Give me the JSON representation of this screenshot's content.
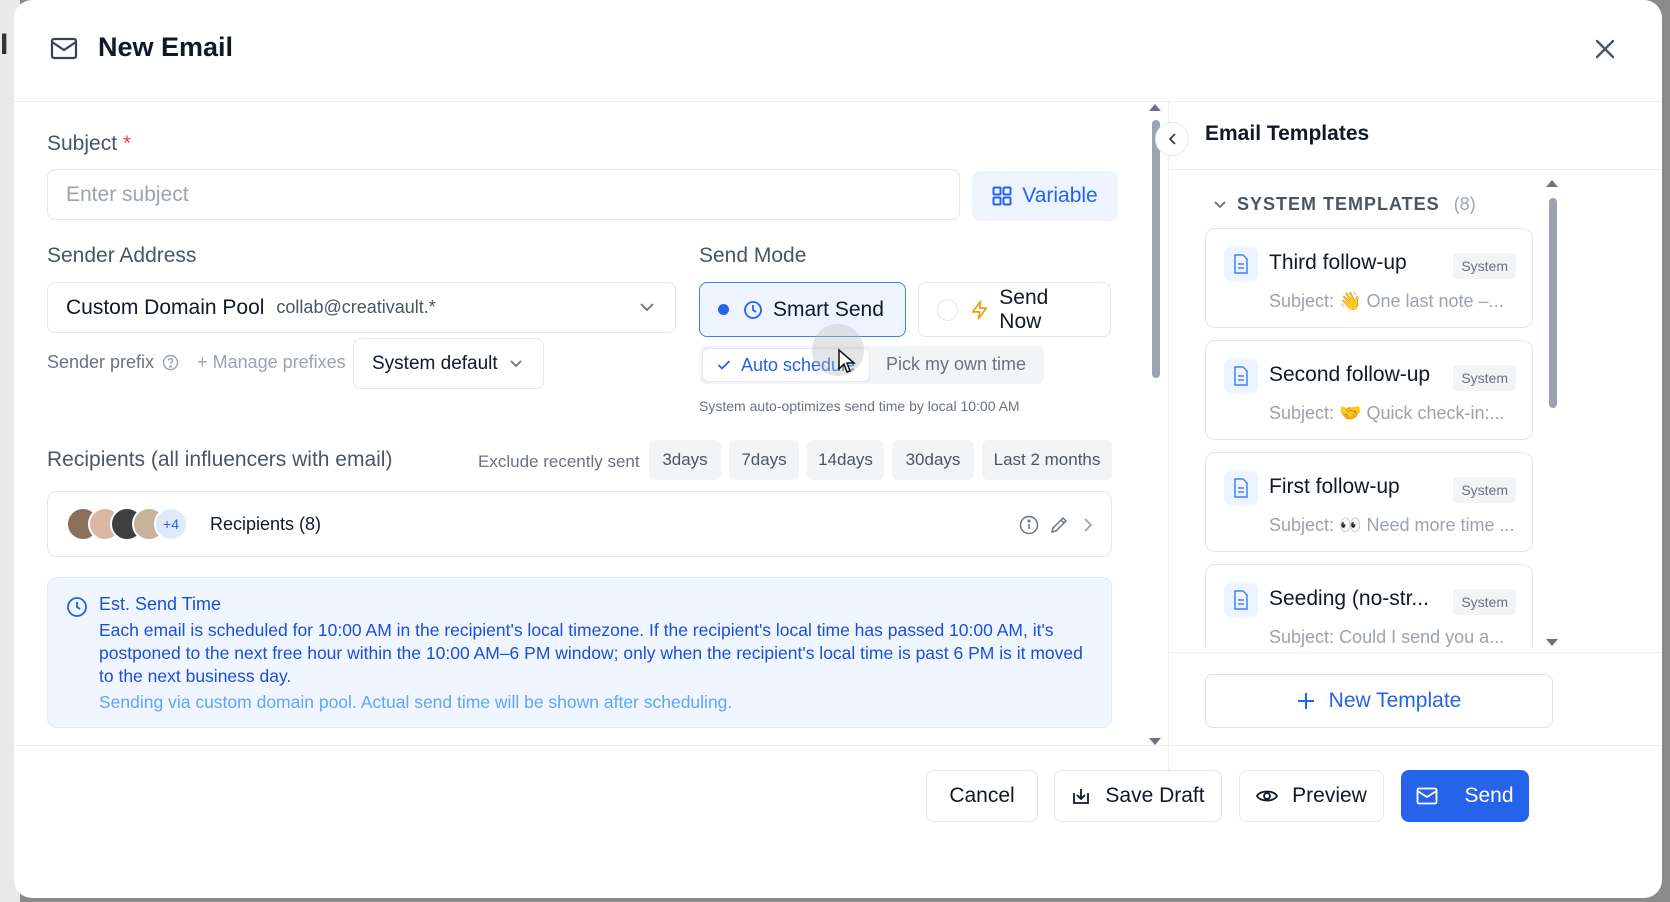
{
  "modal": {
    "title": "New Email",
    "icon": "mail-icon"
  },
  "subject": {
    "label": "Subject",
    "required_mark": "*",
    "placeholder": "Enter subject",
    "value": "",
    "variable_button": "Variable"
  },
  "sender": {
    "label": "Sender Address",
    "pool_name": "Custom Domain Pool",
    "pool_address": "collab@creativault.*",
    "prefix_label": "Sender prefix",
    "manage_prefixes": "+ Manage prefixes",
    "prefix_value": "System default"
  },
  "send_mode": {
    "label": "Send Mode",
    "smart_send": "Smart Send",
    "send_now": "Send Now",
    "selected": "Smart Send",
    "auto_schedule": "Auto schedule",
    "pick_time": "Pick my own time",
    "hint": "System auto-optimizes send time by local 10:00 AM"
  },
  "recipients": {
    "label": "Recipients (all influencers with email)",
    "exclude_label": "Exclude recently sent",
    "exclude_options": [
      "3days",
      "7days",
      "14days",
      "30days",
      "Last 2 months"
    ],
    "more_count": "+4",
    "summary": "Recipients (8)"
  },
  "est_send": {
    "title": "Est. Send Time",
    "body": "Each email is scheduled for 10:00 AM in the recipient's local timezone. If the recipient's local time has passed 10:00 AM, it's postponed to the next free hour within the 10:00 AM–6 PM window; only when the recipient's local time is past 6 PM is it moved to the next business day.",
    "note": "Sending via custom domain pool. Actual send time will be shown after scheduling."
  },
  "templates": {
    "title": "Email Templates",
    "section": "SYSTEM TEMPLATES",
    "section_count": "(8)",
    "items": [
      {
        "name": "Third follow-up",
        "badge": "System",
        "subject_prefix": "Subject:",
        "emoji": "👋",
        "subject": "One last note –..."
      },
      {
        "name": "Second follow-up",
        "badge": "System",
        "subject_prefix": "Subject:",
        "emoji": "🤝",
        "subject": "Quick check-in:..."
      },
      {
        "name": "First follow-up",
        "badge": "System",
        "subject_prefix": "Subject:",
        "emoji": "👀",
        "subject": "Need more time ..."
      },
      {
        "name": "Seeding (no-str...",
        "badge": "System",
        "subject_prefix": "Subject:",
        "emoji": "",
        "subject": "Could I send you a..."
      }
    ],
    "new_template": "New Template"
  },
  "footer": {
    "cancel": "Cancel",
    "save_draft": "Save Draft",
    "preview": "Preview",
    "send": "Send"
  },
  "colors": {
    "accent": "#2563eb",
    "required": "#ef4444",
    "info_bg": "#eff6ff"
  }
}
